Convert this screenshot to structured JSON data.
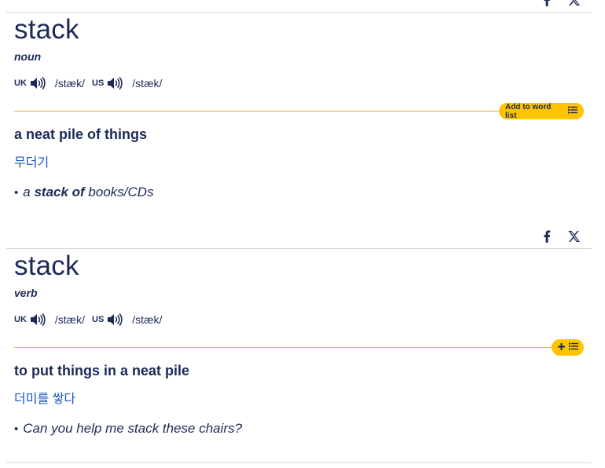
{
  "entries": [
    {
      "headword": "stack",
      "pos": "noun",
      "pron": {
        "uk_label": "UK",
        "uk_ipa": "/stæk/",
        "us_label": "US",
        "us_ipa": "/stæk/"
      },
      "word_list_button": "Add to word list",
      "definition": "a neat pile of things",
      "translation": "무더기",
      "example": {
        "pre": "a ",
        "bold": "stack of",
        "post": " books/CDs"
      }
    },
    {
      "headword": "stack",
      "pos": "verb",
      "pron": {
        "uk_label": "UK",
        "uk_ipa": "/stæk/",
        "us_label": "US",
        "us_ipa": "/stæk/"
      },
      "definition": "to put things in a neat pile",
      "translation": "더미를 쌓다",
      "example": {
        "text": "Can you help me stack these chairs?"
      }
    }
  ],
  "icons": {
    "facebook": "facebook-icon",
    "x": "x-icon",
    "speaker": "speaker-icon",
    "list": "list-icon",
    "plus": "plus-icon"
  },
  "colors": {
    "navy": "#1d2a57",
    "link_blue": "#1a56c4",
    "gold": "#fec400"
  }
}
